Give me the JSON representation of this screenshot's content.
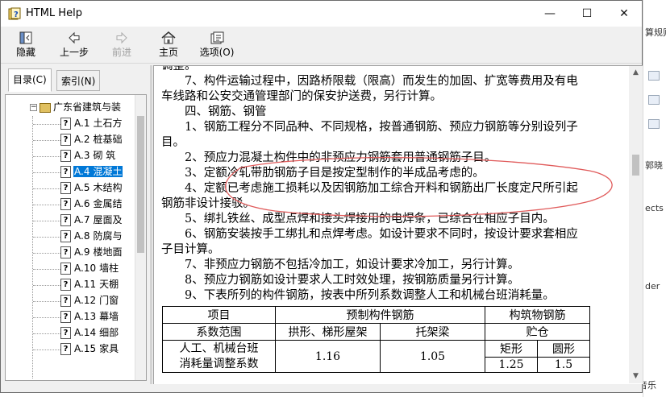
{
  "window": {
    "title": "HTML Help",
    "controls": {
      "minimize": "—",
      "maximize": "☐",
      "close": "✕"
    }
  },
  "toolbar": {
    "hide": "隐藏",
    "back": "上一步",
    "forward": "前进",
    "home": "主页",
    "options": "选项(O)"
  },
  "nav": {
    "tabs": {
      "contents": "目录(C)",
      "index": "索引(N)"
    },
    "root": "广东省建筑与装",
    "items": [
      {
        "code": "A.1",
        "label": "土石方"
      },
      {
        "code": "A.2",
        "label": "桩基础"
      },
      {
        "code": "A.3",
        "label": "砌 筑"
      },
      {
        "code": "A.4",
        "label": "混凝土"
      },
      {
        "code": "A.5",
        "label": "木结构"
      },
      {
        "code": "A.6",
        "label": "金属结"
      },
      {
        "code": "A.7",
        "label": "屋面及"
      },
      {
        "code": "A.8",
        "label": "防腐与"
      },
      {
        "code": "A.9",
        "label": "楼地面"
      },
      {
        "code": "A.10",
        "label": "墙柱"
      },
      {
        "code": "A.11",
        "label": "天棚"
      },
      {
        "code": "A.12",
        "label": "门窗"
      },
      {
        "code": "A.13",
        "label": "幕墙"
      },
      {
        "code": "A.14",
        "label": "细部"
      },
      {
        "code": "A.15",
        "label": "家具"
      }
    ],
    "selected_index": 3
  },
  "content": {
    "lines": [
      "调整。",
      "　　7、构件运输过程中，因路桥限载（限高）而发生的加固、扩宽等费用及有电",
      "车线路和公安交通管理部门的保安护送费，另行计算。",
      "　　四、钢筋、钢管",
      "　　1、钢筋工程分不同品种、不同规格，按普通钢筋、预应力钢筋等分别设列子",
      "目。",
      "　　2、预应力混凝土构件中的非预应力钢筋套用普通钢筋子目。",
      "　　3、定额冷轧带肋钢筋子目是按定型制作的半成品考虑的。",
      "　　4、定额已考虑施工损耗以及因钢筋加工综合开料和钢筋出厂长度定尺所引起",
      "钢筋非设计接驳。",
      "　　5、绑扎铁丝、成型点焊和接头焊接用的电焊条，已综合在相应子目内。",
      "　　6、钢筋安装按手工绑扎和点焊考虑。如设计要求不同时，按设计要求套相应",
      "子目计算。",
      "　　7、非预应力钢筋不包括冷加工，如设计要求冷加工，另行计算。",
      "　　8、预应力钢筋如设计要求人工时效处理，按钢筋质量另行计算。",
      "　　9、下表所列的构件钢筋，按表中所列系数调整人工和机械台班消耗量。"
    ],
    "table": {
      "h_item": "项目",
      "h_prefab": "预制构件钢筋",
      "h_struct": "构筑物钢筋",
      "h_range": "系数范围",
      "c_arch": "拱形、梯形屋架",
      "c_truss": "托架梁",
      "c_silo": "贮仓",
      "c_rect": "矩形",
      "c_round": "圆形",
      "r_label1": "人工、机械台班",
      "r_label2": "消耗量调整系数",
      "v_arch": "1.16",
      "v_truss": "1.05",
      "v_rect": "1.25",
      "v_round": "1.5"
    }
  },
  "background_app": {
    "lines": [
      "算规则",
      "郭晓",
      "ects",
      "der",
      "音乐"
    ]
  }
}
